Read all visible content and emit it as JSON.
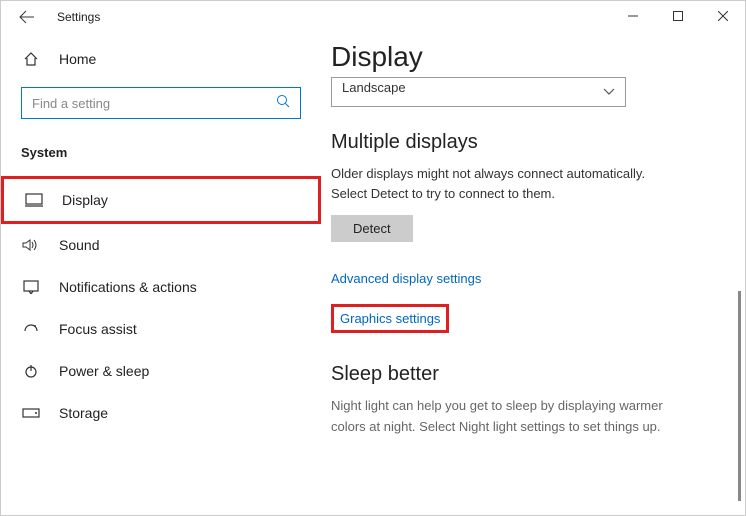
{
  "titlebar": {
    "title": "Settings"
  },
  "sidebar": {
    "home_label": "Home",
    "search_placeholder": "Find a setting",
    "section_header": "System",
    "items": [
      {
        "label": "Display",
        "selected": true
      },
      {
        "label": "Sound"
      },
      {
        "label": "Notifications & actions"
      },
      {
        "label": "Focus assist"
      },
      {
        "label": "Power & sleep"
      },
      {
        "label": "Storage"
      }
    ]
  },
  "main": {
    "page_title": "Display",
    "orientation_value": "Landscape",
    "multi_head": "Multiple displays",
    "multi_desc": "Older displays might not always connect automatically. Select Detect to try to connect to them.",
    "detect_label": "Detect",
    "link_advanced": "Advanced display settings",
    "link_graphics": "Graphics settings",
    "sleep_head": "Sleep better",
    "sleep_desc": "Night light can help you get to sleep by displaying warmer colors at night. Select Night light settings to set things up."
  }
}
